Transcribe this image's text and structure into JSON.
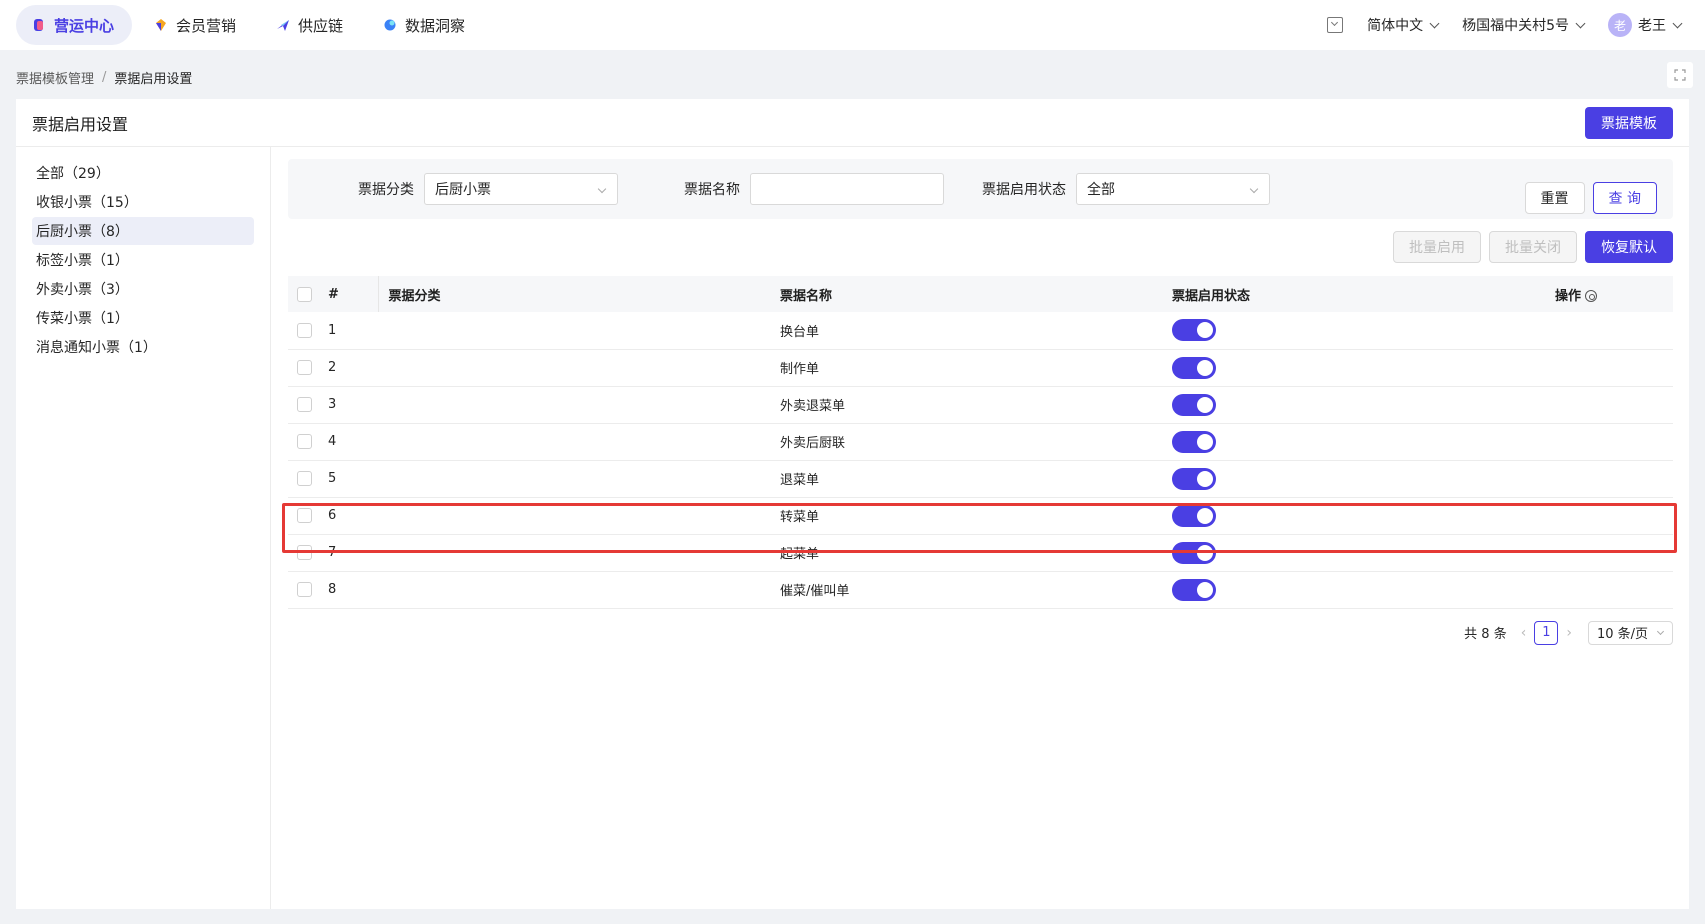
{
  "topnav": {
    "items": [
      {
        "label": "营运中心",
        "icon": "cube-icon",
        "color": "#4a3fe3"
      },
      {
        "label": "会员营销",
        "icon": "diamond-icon",
        "color": "#f5a623"
      },
      {
        "label": "供应链",
        "icon": "plane-icon",
        "color": "#4a3fe3"
      },
      {
        "label": "数据洞察",
        "icon": "orb-icon",
        "color": "#3b82f6"
      }
    ],
    "language": "简体中文",
    "store": "杨国福中关村5号",
    "user_avatar": "老",
    "user_name": "老王"
  },
  "breadcrumb": {
    "parent": "票据模板管理",
    "current": "票据启用设置"
  },
  "card": {
    "title": "票据启用设置",
    "template_button": "票据模板"
  },
  "sidebar": {
    "items": [
      {
        "label": "全部（29）"
      },
      {
        "label": "收银小票（15）"
      },
      {
        "label": "后厨小票（8）"
      },
      {
        "label": "标签小票（1）"
      },
      {
        "label": "外卖小票（3）"
      },
      {
        "label": "传菜小票（1）"
      },
      {
        "label": "消息通知小票（1）"
      }
    ],
    "active_index": 2
  },
  "filters": {
    "category_label": "票据分类",
    "category_value": "后厨小票",
    "name_label": "票据名称",
    "name_value": "",
    "status_label": "票据启用状态",
    "status_value": "全部",
    "reset": "重置",
    "query": "查 询"
  },
  "actions": {
    "batch_enable": "批量启用",
    "batch_disable": "批量关闭",
    "restore_default": "恢复默认"
  },
  "table": {
    "headers": {
      "index": "#",
      "category": "票据分类",
      "name": "票据名称",
      "status": "票据启用状态",
      "operation": "操作"
    },
    "rows": [
      {
        "index": "1",
        "category": "",
        "name": "换台单",
        "enabled": true
      },
      {
        "index": "2",
        "category": "",
        "name": "制作单",
        "enabled": true
      },
      {
        "index": "3",
        "category": "",
        "name": "外卖退菜单",
        "enabled": true
      },
      {
        "index": "4",
        "category": "",
        "name": "外卖后厨联",
        "enabled": true
      },
      {
        "index": "5",
        "category": "",
        "name": "退菜单",
        "enabled": true
      },
      {
        "index": "6",
        "category": "",
        "name": "转菜单",
        "enabled": true
      },
      {
        "index": "7",
        "category": "",
        "name": "起菜单",
        "enabled": true
      },
      {
        "index": "8",
        "category": "",
        "name": "催菜/催叫单",
        "enabled": true
      }
    ]
  },
  "pagination": {
    "total": "共 8 条",
    "current_page": "1",
    "page_size": "10 条/页"
  },
  "colors": {
    "primary": "#4a3fe3",
    "highlight": "#e53935"
  }
}
